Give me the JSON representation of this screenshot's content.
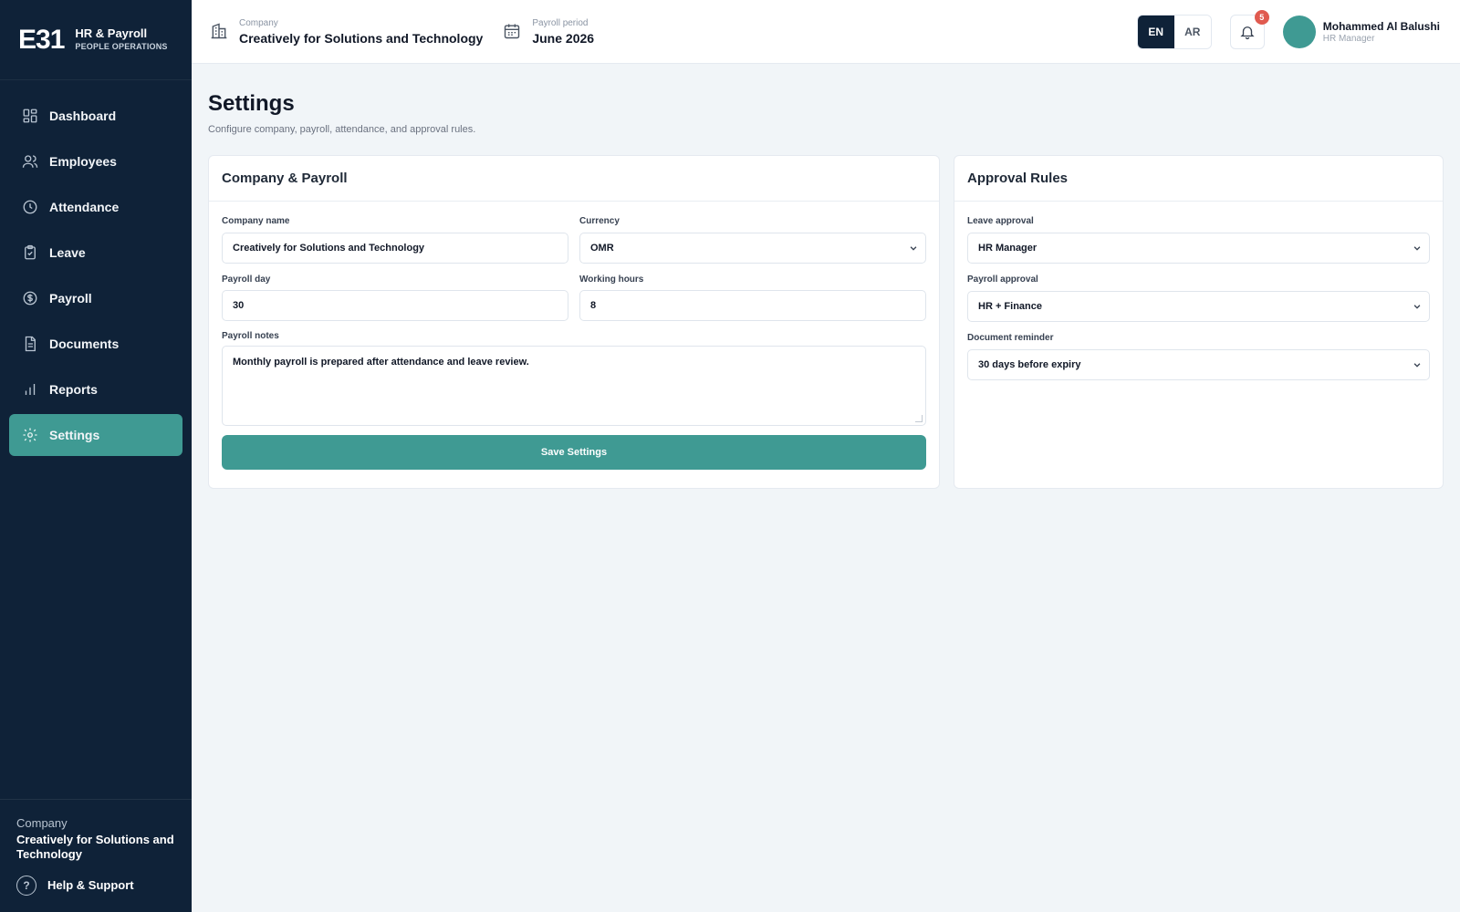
{
  "brand": {
    "logo": "E31",
    "title": "HR & Payroll",
    "subtitle": "PEOPLE OPERATIONS"
  },
  "sidebar": {
    "items": [
      {
        "label": "Dashboard",
        "icon": "dashboard-icon"
      },
      {
        "label": "Employees",
        "icon": "users-icon"
      },
      {
        "label": "Attendance",
        "icon": "clock-icon"
      },
      {
        "label": "Leave",
        "icon": "clipboard-icon"
      },
      {
        "label": "Payroll",
        "icon": "dollar-icon"
      },
      {
        "label": "Documents",
        "icon": "document-icon"
      },
      {
        "label": "Reports",
        "icon": "bar-chart-icon"
      },
      {
        "label": "Settings",
        "icon": "gear-icon",
        "active": true
      }
    ],
    "footer": {
      "company_label": "Company",
      "company_name": "Creatively for Solutions and Technology",
      "help_label": "Help & Support"
    }
  },
  "topbar": {
    "company_label": "Company",
    "company_value": "Creatively for Solutions and Technology",
    "period_label": "Payroll period",
    "period_value": "June 2026",
    "lang_en": "EN",
    "lang_ar": "AR",
    "notifications": "5",
    "user_name": "Mohammed Al Balushi",
    "user_role": "HR Manager"
  },
  "page": {
    "title": "Settings",
    "subtitle": "Configure company, payroll, attendance, and approval rules."
  },
  "company_payroll": {
    "title": "Company & Payroll",
    "company_name_label": "Company name",
    "company_name_value": "Creatively for Solutions and Technology",
    "currency_label": "Currency",
    "currency_value": "OMR",
    "payroll_day_label": "Payroll day",
    "payroll_day_value": "30",
    "working_hours_label": "Working hours",
    "working_hours_value": "8",
    "notes_label": "Payroll notes",
    "notes_value": "Monthly payroll is prepared after attendance and leave review.",
    "save_label": "Save Settings"
  },
  "approval_rules": {
    "title": "Approval Rules",
    "leave_label": "Leave approval",
    "leave_value": "HR Manager",
    "payroll_label": "Payroll approval",
    "payroll_value": "HR + Finance",
    "reminder_label": "Document reminder",
    "reminder_value": "30 days before expiry"
  },
  "colors": {
    "sidebar_bg": "#0f2238",
    "accent": "#3f9a93",
    "badge": "#e05a4f",
    "page_bg": "#f1f5f8"
  }
}
